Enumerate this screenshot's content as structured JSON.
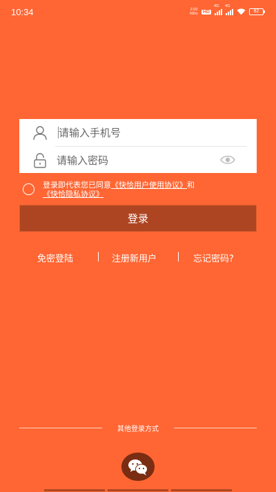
{
  "status_bar": {
    "time": "10:34",
    "net_speed_value": "2.00",
    "net_speed_unit": "KB/s",
    "hd_label": "HD",
    "signal1_label": "4G",
    "signal2_label": "4G",
    "battery": "82"
  },
  "login_form": {
    "phone_placeholder": "请输入手机号",
    "phone_value": "",
    "password_placeholder": "请输入密码",
    "password_value": ""
  },
  "agreement": {
    "checked": false,
    "prefix": "登录即代表您已同意",
    "user_agreement": "《快恰用户使用协议》",
    "connector": "和",
    "privacy_agreement": "《快恰隐私协议》"
  },
  "login_button_label": "登录",
  "links": {
    "free_login": "免密登陆",
    "register": "注册新用户",
    "forgot_password": "忘记密码?"
  },
  "other_login_label": "其他登录方式",
  "colors": {
    "background": "#ff6633",
    "button": "#ae4522",
    "wechat_circle": "#7a2d12"
  },
  "icons": {
    "phone_field": "user-icon",
    "password_field": "lock-icon",
    "password_visibility": "eye-icon",
    "social_login": "wechat-icon"
  }
}
